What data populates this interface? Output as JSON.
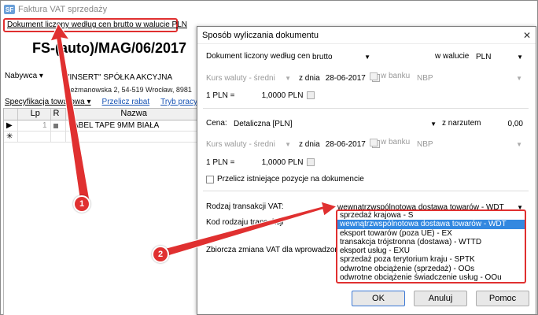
{
  "bg": {
    "window_title": "Faktura VAT sprzedaży",
    "app_icon_text": "SF",
    "doc_basis_link": "Dokument liczony według cen brutto w walucie PLN",
    "doc_number": "FS-(auto)/MAG/06/2017",
    "nabywca_label": "Nabywca",
    "customer_name": "\"INSERT\" SPÓŁKA AKCYJNA",
    "customer_address": "Jeżmanowska 2, 54-519 Wrocław, 8981",
    "spec_label": "Specyfikacja towarowa",
    "przelicz_rabat": "Przelicz rabat",
    "tryb_pracy": "Tryb pracy - Z",
    "grid": {
      "headers": [
        "Lp",
        "R",
        "Nazwa"
      ],
      "rows": [
        {
          "lp": "1",
          "r": "",
          "nazwa": "LABEL TAPE 9MM BIAŁA"
        }
      ]
    }
  },
  "dialog": {
    "title": "Sposób wyliczania dokumentu",
    "close_glyph": "✕",
    "doc_basis_label": "Dokument liczony według cen",
    "doc_basis_value": "brutto",
    "currency_label": "w walucie",
    "currency_value": "PLN",
    "rate1": {
      "kurs_label": "Kurs waluty - średni",
      "date_label": "z dnia",
      "date_value": "28-06-2017",
      "bank_label": "w banku",
      "bank_value": "NBP",
      "conv_left": "1 PLN =",
      "conv_value": "1,0000 PLN"
    },
    "cena_label": "Cena:",
    "cena_value": "Detaliczna [PLN]",
    "narzut_label": "z narzutem",
    "narzut_value": "0,00",
    "rate2": {
      "kurs_label": "Kurs waluty - średni",
      "date_label": "z dnia",
      "date_value": "28-06-2017",
      "bank_label": "w banku",
      "bank_value": "NBP",
      "conv_left": "1 PLN =",
      "conv_value": "1,0000 PLN"
    },
    "recalc_label": "Przelicz istniejące pozycje na dokumencie",
    "vat_trans_label": "Rodzaj transakcji VAT:",
    "vat_trans_value": "wewnątrzwspólnotowa dostawa towarów - WDT",
    "kod_label": "Kod rodzaju transakcji",
    "zbiorcza_label": "Zbiorcza zmiana VAT dla wprowadzonych",
    "options": [
      "sprzedaż krajowa - S",
      "wewnątrzwspólnotowa dostawa towarów - WDT",
      "eksport towarów (poza UE) - EX",
      "transakcja trójstronna (dostawa) - WTTD",
      "eksport usług - EXU",
      "sprzedaż poza terytorium kraju - SPTK",
      "odwrotne obciążenie (sprzedaż) - OOs",
      "odwrotne obciążenie świadczenie usług - OOu"
    ],
    "selected_option_index": 1,
    "ok_label": "OK",
    "cancel_label": "Anuluj",
    "help_label": "Pomoc"
  },
  "annotations": {
    "callout1": "1",
    "callout2": "2",
    "color": "#e03030"
  }
}
